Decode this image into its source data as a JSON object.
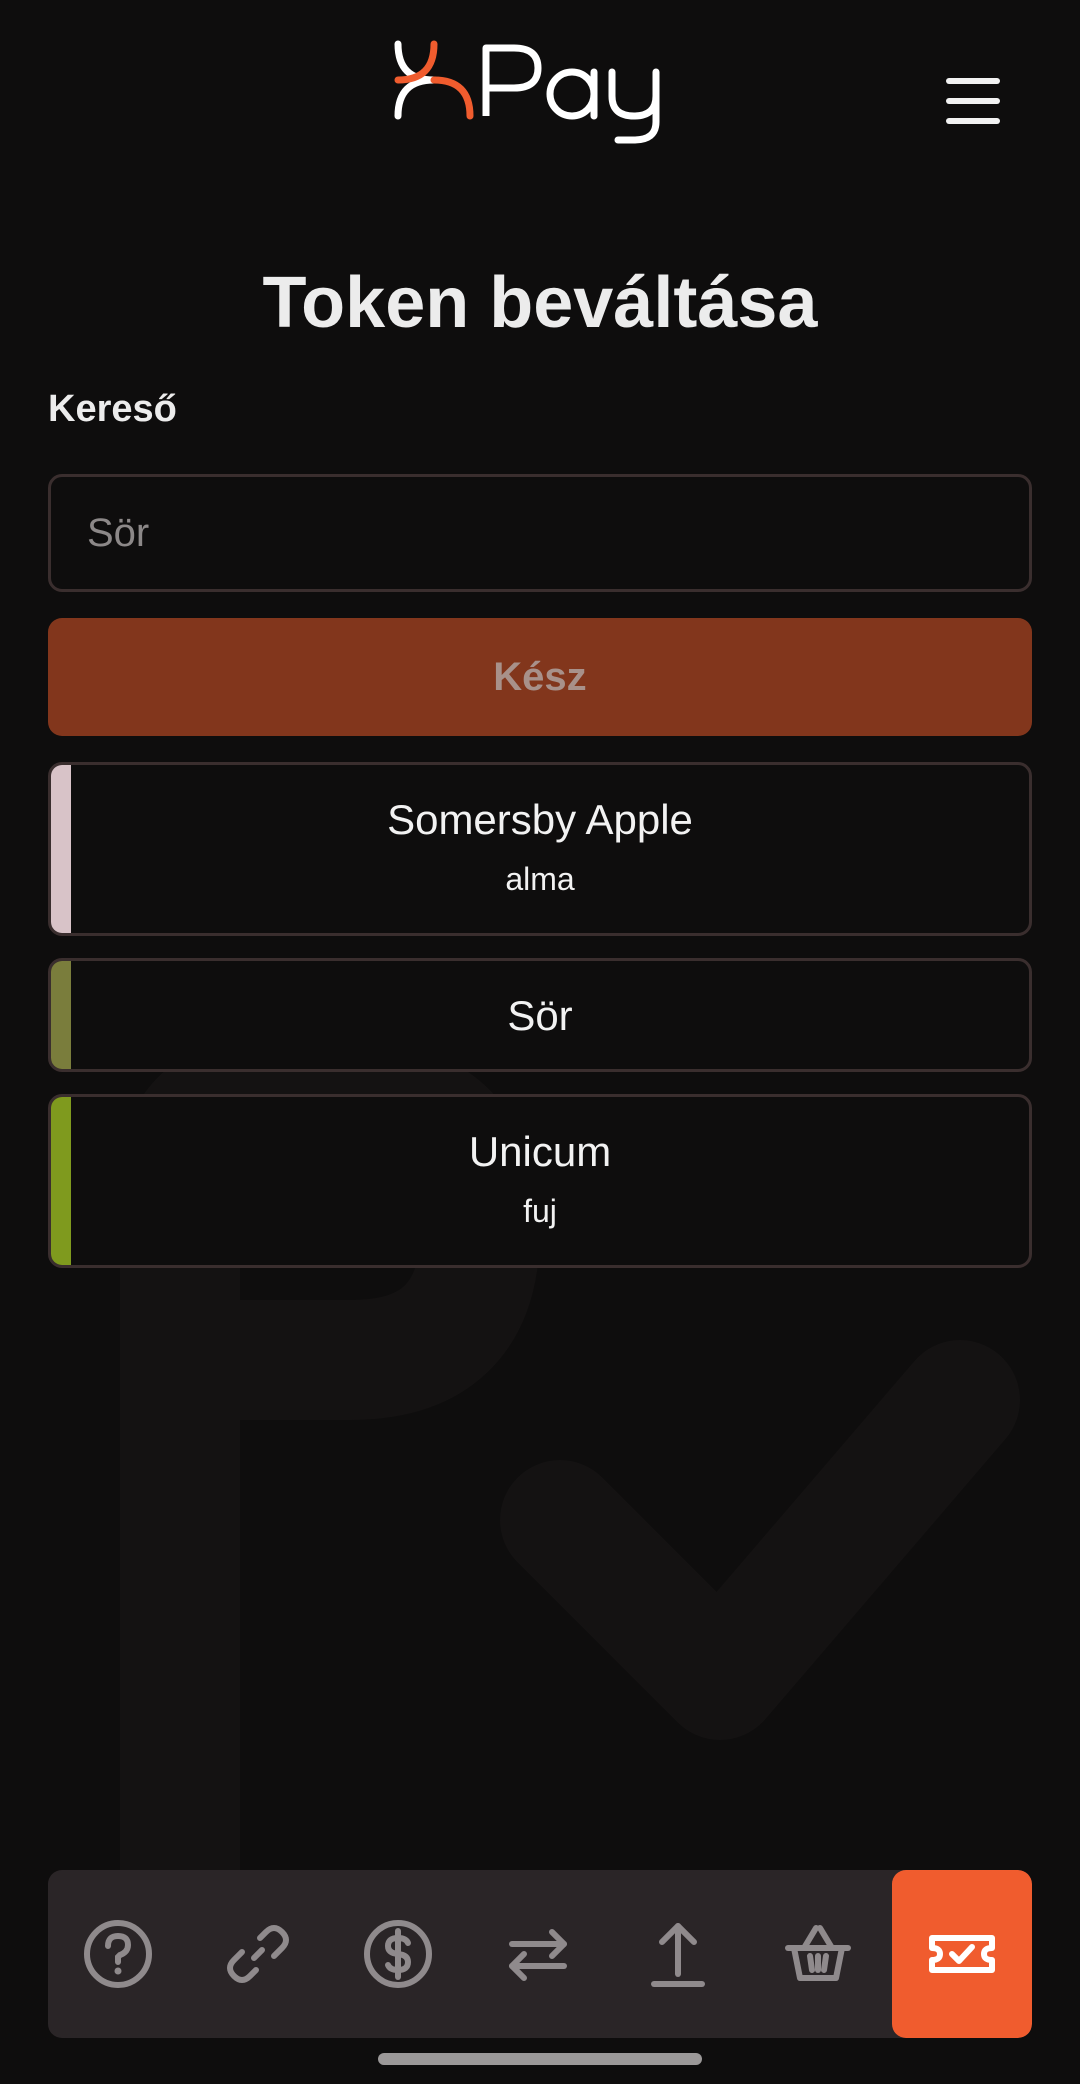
{
  "header": {
    "logo_text": "KRPay",
    "menu_icon": "hamburger-menu-icon"
  },
  "page": {
    "title": "Token beváltása"
  },
  "search": {
    "label": "Kereső",
    "placeholder": "Sör",
    "value": ""
  },
  "done_button": {
    "label": "Kész"
  },
  "tokens": [
    {
      "name": "Somersby Apple",
      "description": "alma",
      "color": "#d8c3c8"
    },
    {
      "name": "Sör",
      "description": "",
      "color": "#7a7d3c"
    },
    {
      "name": "Unicum",
      "description": "fuj",
      "color": "#7f9a1e"
    }
  ],
  "bottom_nav": {
    "items": [
      {
        "icon": "help-icon",
        "active": false
      },
      {
        "icon": "link-icon",
        "active": false
      },
      {
        "icon": "dollar-icon",
        "active": false
      },
      {
        "icon": "transfer-icon",
        "active": false
      },
      {
        "icon": "upload-icon",
        "active": false
      },
      {
        "icon": "basket-icon",
        "active": false
      },
      {
        "icon": "ticket-check-icon",
        "active": true
      }
    ]
  },
  "colors": {
    "background": "#0e0d0d",
    "accent": "#f05c2e",
    "button_disabled": "#82361c",
    "nav_background": "#2a2527",
    "border": "#3a2e2e"
  }
}
